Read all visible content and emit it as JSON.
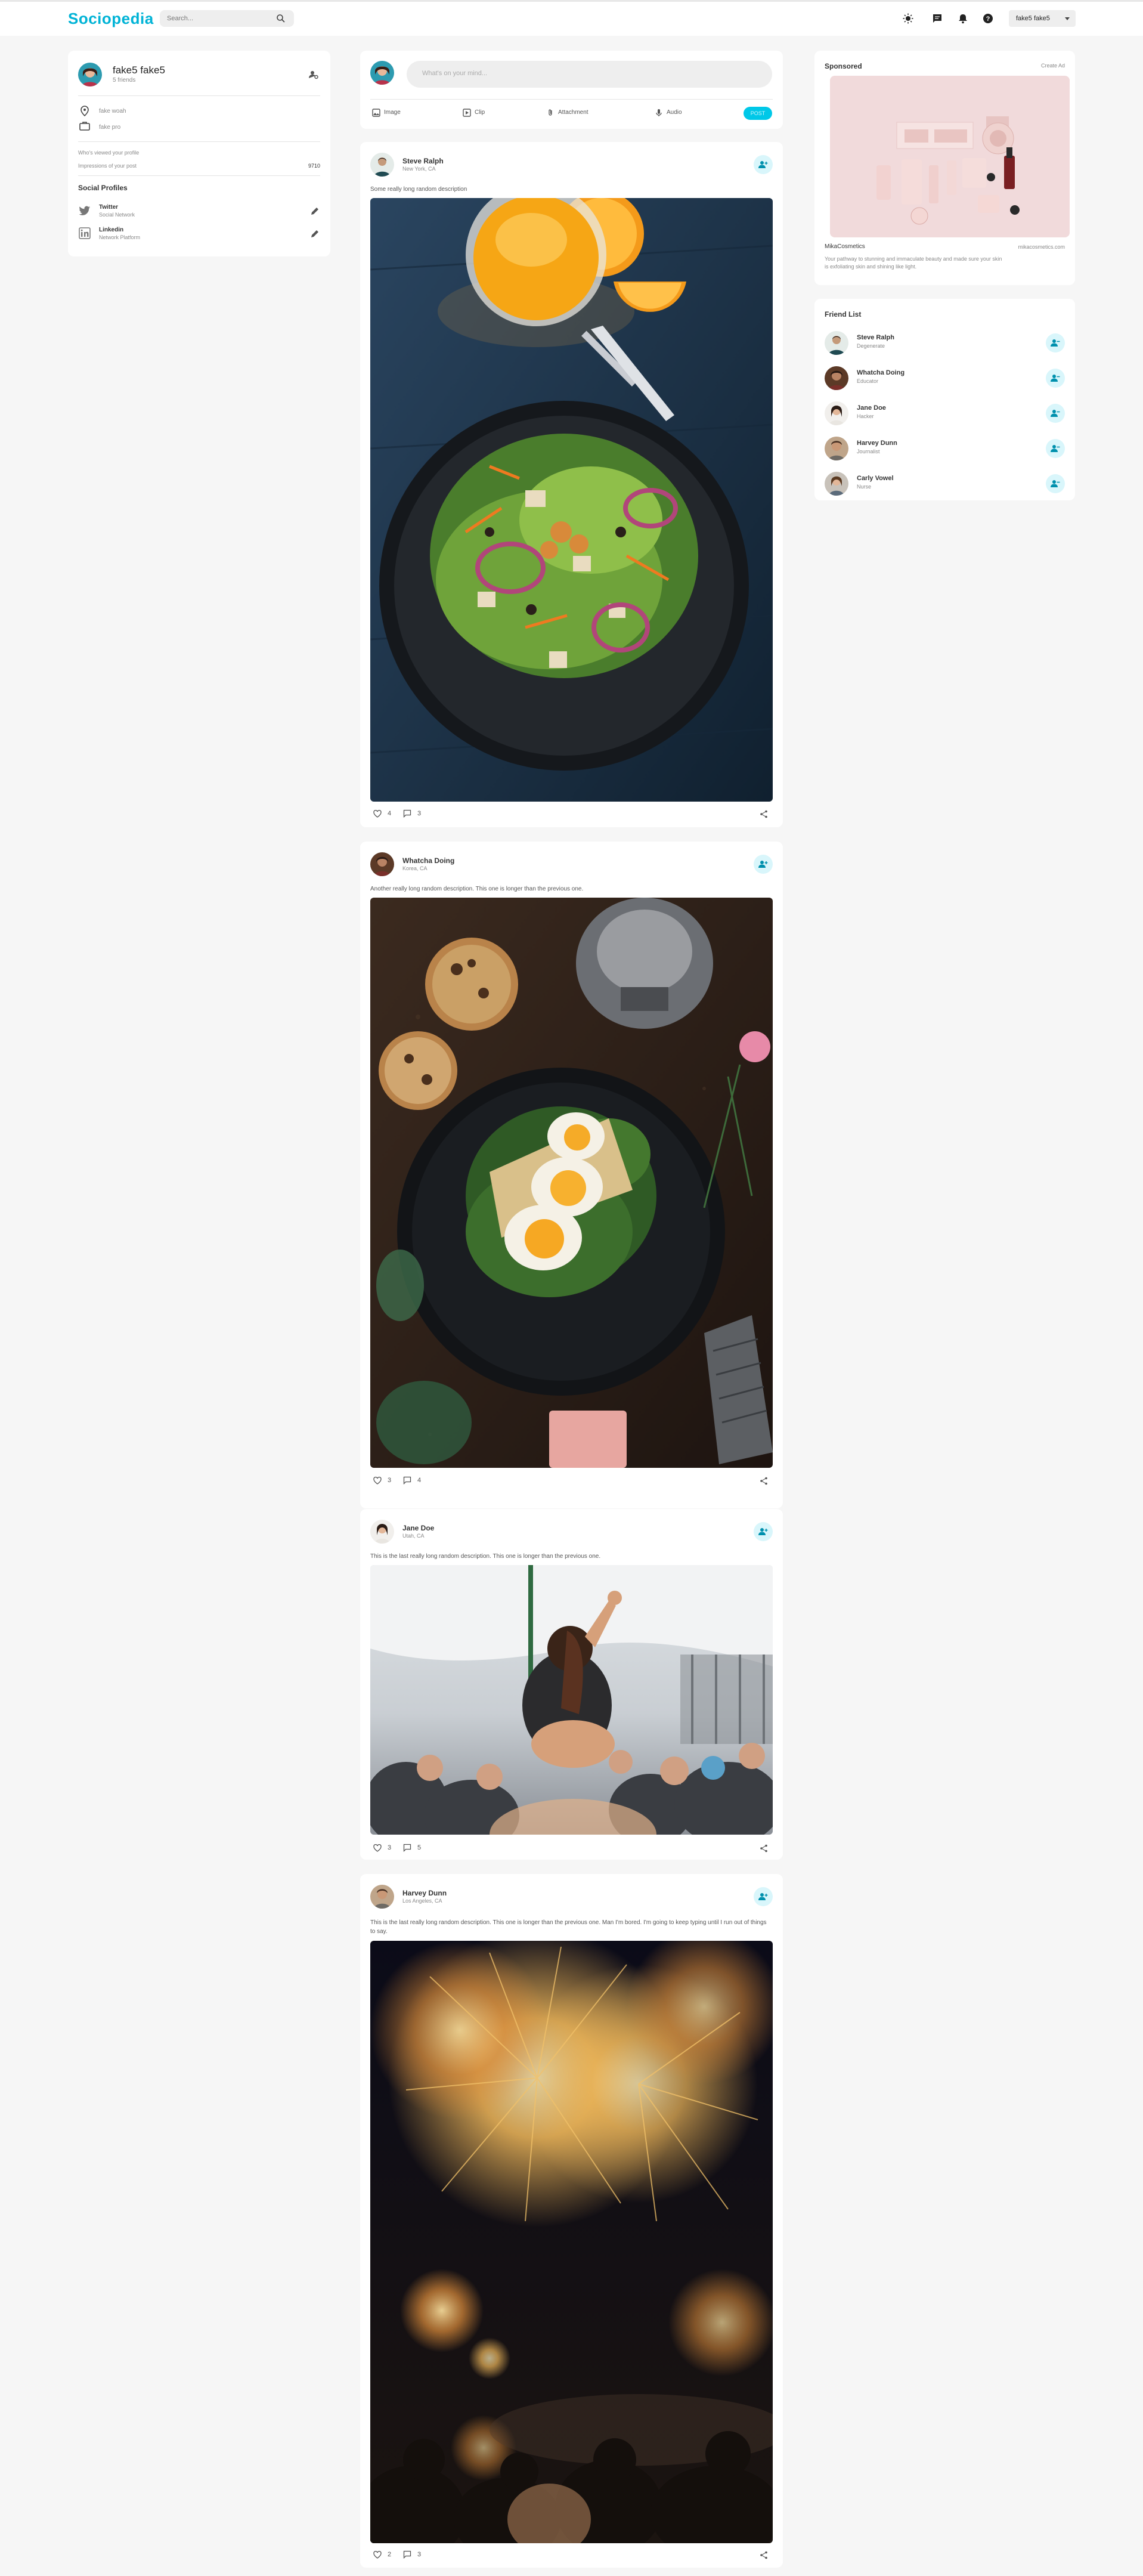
{
  "app": {
    "name": "Sociopedia"
  },
  "header": {
    "search_placeholder": "Search...",
    "user_name": "fake5 fake5",
    "icons": [
      "dark-mode-icon",
      "messages-icon",
      "notifications-icon",
      "help-icon"
    ]
  },
  "profile": {
    "name": "fake5 fake5",
    "friends": "5 friends",
    "location": "fake woah",
    "occupation": "fake pro",
    "viewed_label": "Who's viewed your profile",
    "viewed_value": "",
    "impressions_label": "Impressions of your post",
    "impressions_value": "9710",
    "social_title": "Social Profiles",
    "social": [
      {
        "name": "Twitter",
        "desc": "Social Network"
      },
      {
        "name": "Linkedin",
        "desc": "Network Platform"
      }
    ]
  },
  "composer": {
    "placeholder": "What's on your mind...",
    "actions": [
      "Image",
      "Clip",
      "Attachment",
      "Audio"
    ],
    "post_label": "POST"
  },
  "posts": [
    {
      "author": "Steve Ralph",
      "location": "New York, CA",
      "description": "Some really long random description",
      "likes": "4",
      "comments": "3"
    },
    {
      "author": "Whatcha Doing",
      "location": "Korea, CA",
      "description": "Another really long random description. This one is longer than the previous one.",
      "likes": "3",
      "comments": "4"
    },
    {
      "author": "Jane Doe",
      "location": "Utah, CA",
      "description": "This is the last really long random description. This one is longer than the previous one.",
      "likes": "3",
      "comments": "5"
    },
    {
      "author": "Harvey Dunn",
      "location": "Los Angeles, CA",
      "description": "This is the last really long random description. This one is longer than the previous one. Man I'm bored. I'm going to keep typing until I run out of things to say.",
      "likes": "2",
      "comments": "3"
    }
  ],
  "sponsored": {
    "title": "Sponsored",
    "create": "Create Ad",
    "brand": "MikaCosmetics",
    "site": "mikacosmetics.com",
    "text": "Your pathway to stunning and immaculate beauty and made sure your skin is exfoliating skin and shining like light."
  },
  "friends": {
    "title": "Friend List",
    "list": [
      {
        "name": "Steve Ralph",
        "role": "Degenerate"
      },
      {
        "name": "Whatcha Doing",
        "role": "Educator"
      },
      {
        "name": "Jane Doe",
        "role": "Hacker"
      },
      {
        "name": "Harvey Dunn",
        "role": "Journalist"
      },
      {
        "name": "Carly Vowel",
        "role": "Nurse"
      }
    ]
  },
  "colors": {
    "accent": "#00b3d6",
    "accent_light": "#d9f6fb",
    "background": "#f6f6f6"
  }
}
